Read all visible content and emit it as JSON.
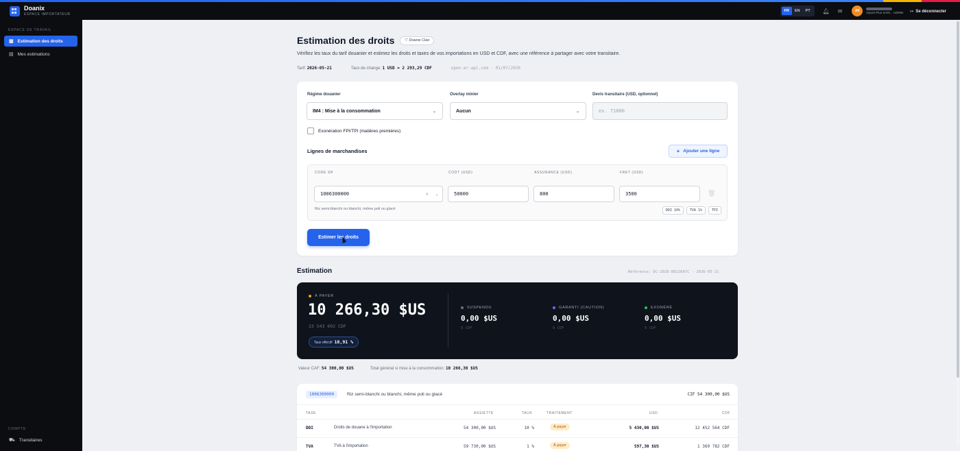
{
  "app": {
    "name": "Doanix",
    "subtitle": "ESPACE IMPORTATEUR"
  },
  "topbar": {
    "languages": [
      {
        "code": "FR",
        "active": true
      },
      {
        "code": "EN",
        "active": false
      },
      {
        "code": "PT",
        "active": false
      }
    ],
    "avatar_initials": "AK",
    "user_role": "Import Plus SARL · ADMIN",
    "logout_label": "Se déconnecter",
    "icons": [
      "bell-icon",
      "mail-icon",
      "logout-icon"
    ]
  },
  "sidebar": {
    "workspace_heading": "ESPACE DE TRAVAIL",
    "items": [
      {
        "label": "Estimation des droits",
        "icon": "calculator-icon",
        "active": true
      },
      {
        "label": "Mes estimations",
        "icon": "document-icon",
        "active": false
      }
    ],
    "account_heading": "COMPTE",
    "account_items": [
      {
        "label": "Transitaires",
        "icon": "truck-icon"
      }
    ]
  },
  "page": {
    "title": "Estimation des droits",
    "pill_label": "Doanix Clair",
    "intro": "Vérifiez les taux du tarif douanier et estimez les droits et taxes de vos importations en USD et CDF, avec une référence à partager avec votre transitaire.",
    "tarif_label": "Tarif",
    "tarif_value": "2026-05-21",
    "rate_label": "Taux de change",
    "rate_value": "1 USD = 2 293,29 CDF",
    "source": "open.er-api.com · 01/07/2026"
  },
  "form": {
    "regime_label": "Régime douanier",
    "regime_value": "IM4 : Mise à la consommation",
    "overlay_label": "Overlay minier",
    "overlay_value": "Aucun",
    "devis_label": "Devis transitaire (USD, optionnel)",
    "devis_placeholder": "ex. 71000",
    "exoneration_label": "Exonération FPI/TPI (matières premières)",
    "lines_title": "Lignes de marchandises",
    "add_line_label": "Ajouter une ligne",
    "columns": [
      "CODE SH",
      "COÛT (USD)",
      "ASSURANCE (USD)",
      "FRET (USD)"
    ],
    "line": {
      "code": "1006300000",
      "cout": "50000",
      "assurance": "800",
      "fret": "3500",
      "description": "Riz semi-blanchi ou blanchi, même poli ou glacé",
      "tags": [
        "DDI 10%",
        "TVA 1%",
        "TPI"
      ]
    },
    "submit_label": "Estimer les droits"
  },
  "estimation": {
    "title": "Estimation",
    "reference": "Référence: DC-2026-B0226A7C · 2026-05-21",
    "pay_label": "À PAYER",
    "pay_value": "10 266,30 $US",
    "pay_cdf": "23 543 602 CDF",
    "rate_label": "Taux effectif",
    "rate_value": "18,91 %",
    "stats": [
      {
        "label": "SUSPENDU",
        "value": "0,00 $US",
        "sub": "0 CDF",
        "color": "#64748b"
      },
      {
        "label": "GARANTI (CAUTION)",
        "value": "0,00 $US",
        "sub": "0 CDF",
        "color": "#8b5cf6"
      },
      {
        "label": "EXONÉRÉ",
        "value": "0,00 $US",
        "sub": "0 CDF",
        "color": "#22c55e"
      }
    ],
    "pay_color": "#f59e0b",
    "caf_label": "Valeur CAF:",
    "caf_value": "54 300,00 $US",
    "total_label": "Total général si mise à la consommation:",
    "total_value": "10 266,30 $US"
  },
  "breakdown": {
    "code": "1006300000",
    "description": "Riz semi-blanchi ou blanchi, même poli ou glacé",
    "cif": "CIF 54 300,00 $US",
    "headers": [
      "TAXE",
      "ASSIETTE",
      "TAUX",
      "TRAITEMENT",
      "USD",
      "CDF"
    ],
    "rows": [
      {
        "code": "DDI",
        "name": "Droits de douane à l'importation",
        "assiette": "54 300,00 $US",
        "taux": "10 %",
        "traitement": "À payer",
        "usd": "5 430,00 $US",
        "cdf": "12 452 564 CDF"
      },
      {
        "code": "TVA",
        "name": "TVA à l'importation",
        "assiette": "59 730,00 $US",
        "taux": "1 %",
        "traitement": "À payer",
        "usd": "597,30 $US",
        "cdf": "1 369 782 CDF"
      }
    ]
  }
}
